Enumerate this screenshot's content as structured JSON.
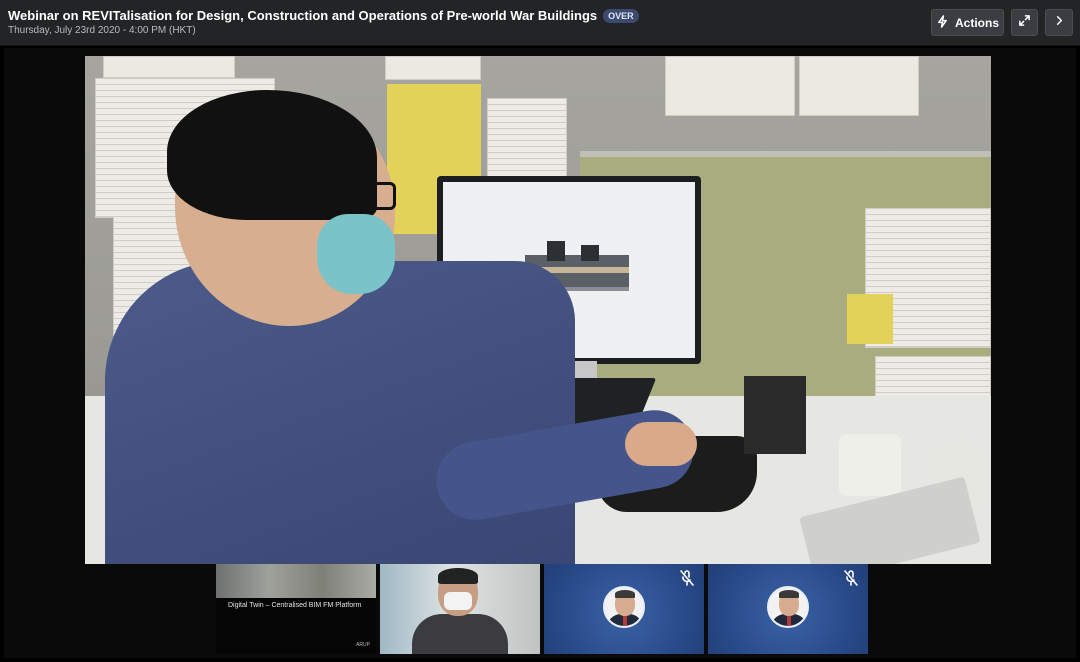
{
  "header": {
    "title": "Webinar on REVITalisation for Design, Construction and Operations of Pre-world War Buildings",
    "status_badge": "OVER",
    "subtitle": "Thursday, July 23rd 2020 - 4:00 PM (HKT)"
  },
  "toolbar": {
    "actions_label": "Actions",
    "actions_icon": "lightning-icon",
    "expand_icon": "expand-icon",
    "next_icon": "chevron-right-icon"
  },
  "main_video": {
    "description_icon": "presenter-video"
  },
  "thumbnails": [
    {
      "type": "slide",
      "caption": "Digital Twin – Centralised BIM FM Platform",
      "logo": "ARUP"
    },
    {
      "type": "camera"
    },
    {
      "type": "avatar",
      "mic_icon": "mic-off-icon"
    },
    {
      "type": "avatar",
      "mic_icon": "mic-off-icon"
    }
  ],
  "colors": {
    "topbar_bg": "#222426",
    "badge_bg": "#3b4a6e",
    "avatar_tile_bg": "#2a4c8c"
  }
}
